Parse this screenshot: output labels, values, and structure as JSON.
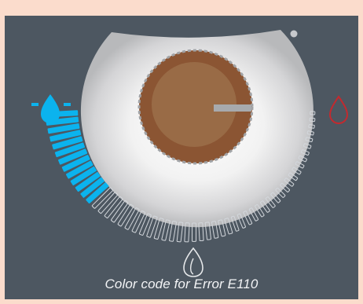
{
  "caption": "Color code for Error E110",
  "dial": {
    "lit_segments": 13,
    "total_segments": 55,
    "lit_color": "#0bb3ee",
    "unlit_color": "#d3d7dc"
  },
  "colors": {
    "background": "#fbdccc",
    "panel": "#4d5761",
    "knob_outer": "#8b5533",
    "knob_inner": "#996b46",
    "indicator": "#a7aaad",
    "hot_icon": "#c22a2f",
    "cold_icon": "#0bb3ee"
  },
  "icons": {
    "cold": "water-drop-icon",
    "neutral": "flame-icon",
    "hot": "hot-drop-icon",
    "status_dot": "status-dot-icon"
  }
}
